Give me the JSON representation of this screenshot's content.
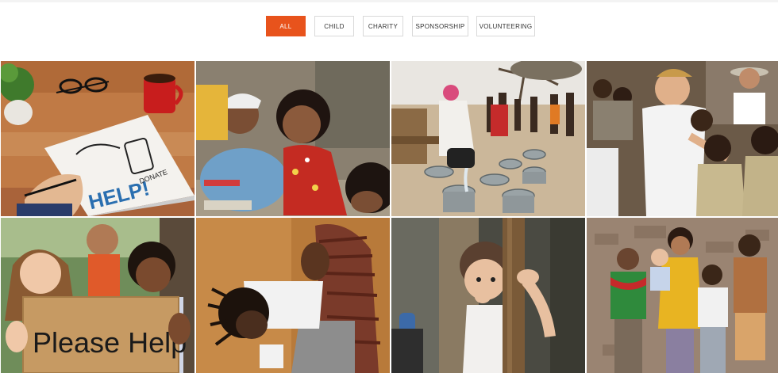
{
  "filters": {
    "items": [
      {
        "label": "All",
        "active": true
      },
      {
        "label": "Child",
        "active": false
      },
      {
        "label": "Charity",
        "active": false
      },
      {
        "label": "Sponsorship",
        "active": false
      },
      {
        "label": "Volunteering",
        "active": false
      }
    ],
    "accent_color": "#e8531c"
  },
  "gallery": {
    "photos": [
      {
        "subject": "notebook-help-photo",
        "text": [
          "HELP!",
          "DONATE"
        ]
      },
      {
        "subject": "smiling-children-photo"
      },
      {
        "subject": "water-buckets-photo"
      },
      {
        "subject": "volunteer-schoolchildren-photo"
      },
      {
        "subject": "please-help-sign-photo",
        "text": [
          "Please Help"
        ]
      },
      {
        "subject": "mother-child-photo"
      },
      {
        "subject": "toddler-post-photo"
      },
      {
        "subject": "children-wall-photo"
      }
    ]
  }
}
